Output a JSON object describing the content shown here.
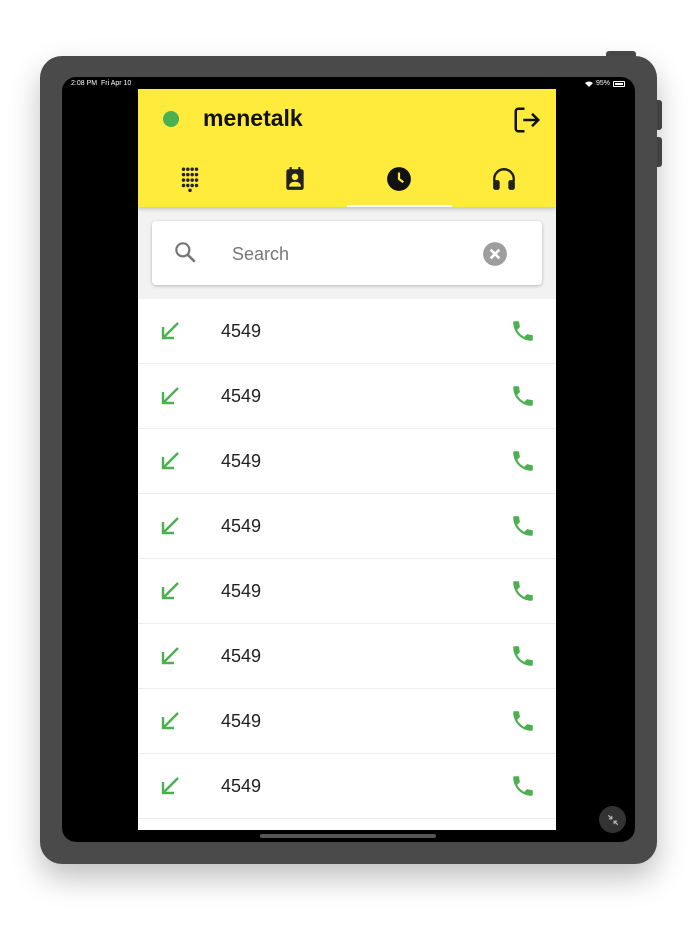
{
  "status_bar": {
    "time": "2:08 PM",
    "date": "Fri Apr 10",
    "battery": "95%",
    "wifi_icon": "wifi-icon"
  },
  "app": {
    "title": "menetalk",
    "status_color": "#4caf50",
    "brand_color": "#ffeb3b",
    "logout_icon": "logout-icon"
  },
  "tabs": [
    {
      "icon": "dialpad-icon",
      "active": false
    },
    {
      "icon": "contacts-icon",
      "active": false
    },
    {
      "icon": "recents-clock-icon",
      "active": true
    },
    {
      "icon": "support-headset-icon",
      "active": false
    }
  ],
  "search": {
    "placeholder": "Search",
    "value": ""
  },
  "calls": [
    {
      "number": "4549",
      "direction": "incoming"
    },
    {
      "number": "4549",
      "direction": "incoming"
    },
    {
      "number": "4549",
      "direction": "incoming"
    },
    {
      "number": "4549",
      "direction": "incoming"
    },
    {
      "number": "4549",
      "direction": "incoming"
    },
    {
      "number": "4549",
      "direction": "incoming"
    },
    {
      "number": "4549",
      "direction": "incoming"
    },
    {
      "number": "4549",
      "direction": "incoming"
    }
  ],
  "accent_call_color": "#4caf50"
}
